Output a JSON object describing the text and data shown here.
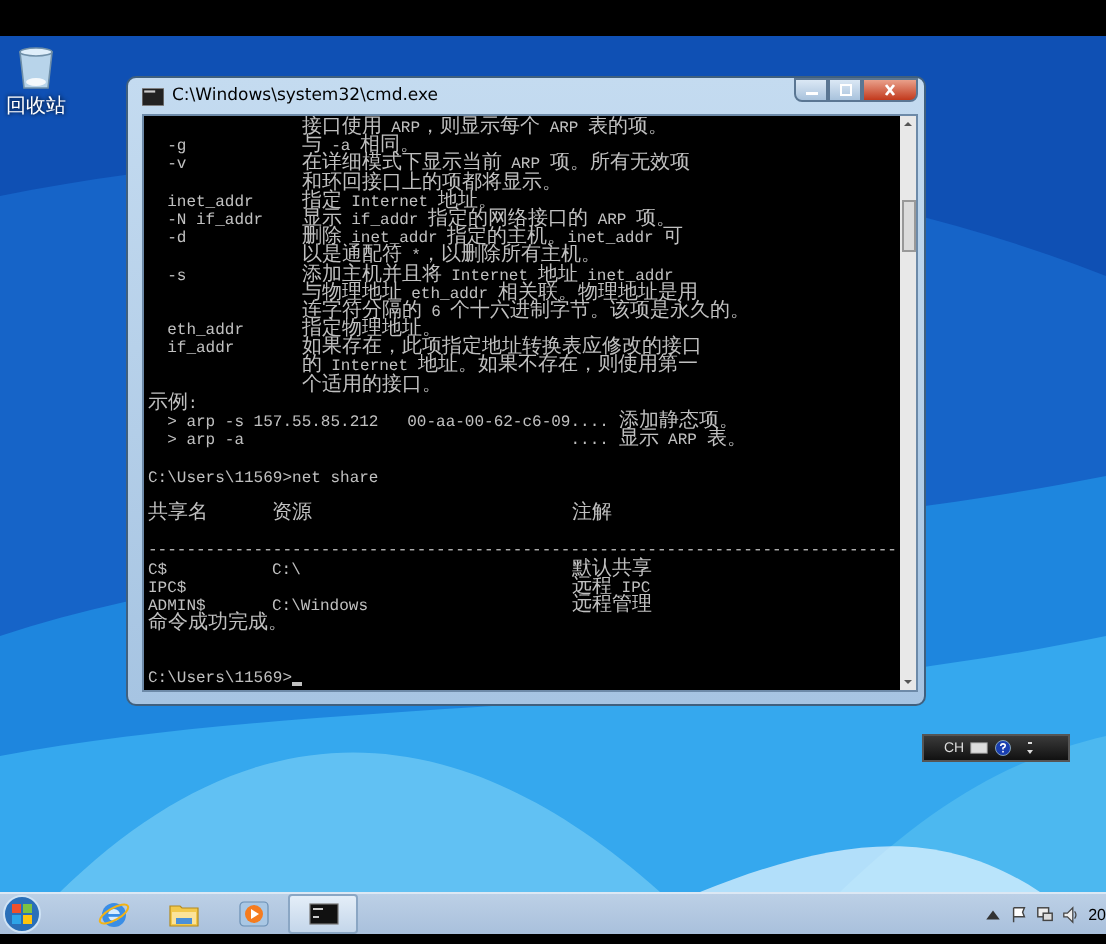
{
  "desktop": {
    "icons": [
      {
        "label": "回收站"
      }
    ]
  },
  "window": {
    "title": "C:\\Windows\\system32\\cmd.exe",
    "console": {
      "blocks": [
        {
          "lines": [
            "                接口使用 ARP，则显示每个 ARP 表的项。",
            "  -g            与 -a 相同。",
            "  -v            在详细模式下显示当前 ARP 项。所有无效项",
            "                和环回接口上的项都将显示。",
            "  inet_addr     指定 Internet 地址。",
            "  -N if_addr    显示 if_addr 指定的网络接口的 ARP 项。",
            "  -d            删除 inet_addr 指定的主机。inet_addr 可",
            "                以是通配符 *，以删除所有主机。",
            "  -s            添加主机并且将 Internet 地址 inet_addr",
            "                与物理地址 eth_addr 相关联。物理地址是用",
            "                连字符分隔的 6 个十六进制字节。该项是永久的。",
            "  eth_addr      指定物理地址。",
            "  if_addr       如果存在，此项指定地址转换表应修改的接口",
            "                的 Internet 地址。如果不存在，则使用第一",
            "                个适用的接口。",
            "示例:",
            "  > arp -s 157.55.85.212   00-aa-00-62-c6-09.... 添加静态项。",
            "  > arp -a                                  .... 显示 ARP 表。"
          ]
        },
        {
          "lines": [
            "C:\\Users\\11569>net share"
          ]
        },
        {
          "kind": "table",
          "columns": [
            "共享名",
            "资源",
            "注解"
          ],
          "rule": "------------------------------------------------------------------------------",
          "rows": [
            {
              "name": "C$",
              "resource": "C:\\",
              "comment": "默认共享"
            },
            {
              "name": "IPC$",
              "comment": "远程 IPC"
            },
            {
              "name": "ADMIN$",
              "resource": "C:\\Windows",
              "comment": "远程管理"
            }
          ],
          "message": "命令成功完成。"
        },
        {
          "kind": "prompt",
          "lines": [
            "C:\\Users\\11569>"
          ]
        }
      ]
    }
  },
  "language_bar": {
    "label": "CH"
  },
  "taskbar": {
    "items": [
      {
        "kind": "browser",
        "selected": false
      },
      {
        "kind": "folder",
        "selected": false
      },
      {
        "kind": "media",
        "selected": false
      },
      {
        "kind": "console",
        "selected": true
      }
    ],
    "clock": "20"
  }
}
